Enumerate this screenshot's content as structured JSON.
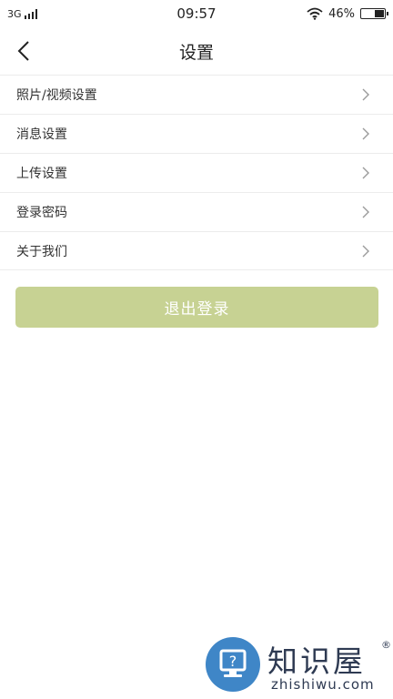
{
  "status_bar": {
    "network": "3G",
    "time": "09:57",
    "battery_percent": "46%",
    "battery_level": 0.46,
    "icons": [
      "signal-icon",
      "wifi-icon",
      "battery-icon"
    ]
  },
  "header": {
    "title": "设置",
    "back_icon": "back-arrow-icon"
  },
  "settings": {
    "items": [
      {
        "label": "照片/视频设置"
      },
      {
        "label": "消息设置"
      },
      {
        "label": "上传设置"
      },
      {
        "label": "登录密码"
      },
      {
        "label": "关于我们"
      }
    ],
    "item_icon": "chevron-right-icon"
  },
  "logout_button": {
    "label": "退出登录"
  },
  "watermark": {
    "title": "知识屋",
    "registered": "®",
    "domain": "zhishiwu.com",
    "icon": "monitor-question-icon"
  },
  "colors": {
    "logout_bg": "#c7d293",
    "divider": "#ececec",
    "watermark_blue": "#3f86c7"
  }
}
